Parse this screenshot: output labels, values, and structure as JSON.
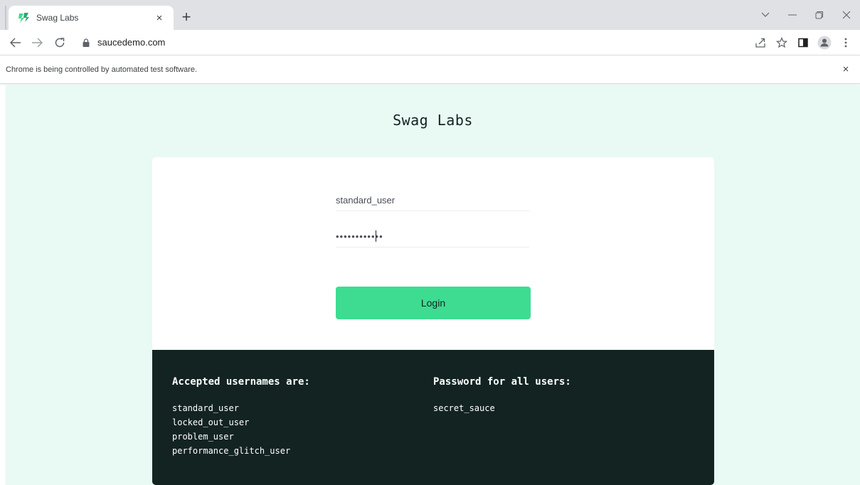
{
  "browser": {
    "tab_title": "Swag Labs",
    "tab_close": "×",
    "new_tab": "+",
    "url": "saucedemo.com",
    "infobar_text": "Chrome is being controlled by automated test software.",
    "infobar_close": "×"
  },
  "page": {
    "logo": "Swag Labs",
    "username_value": "standard_user",
    "password_value": "••••••••••••",
    "login_label": "Login",
    "accepted_usernames_heading": "Accepted usernames are:",
    "usernames": [
      "standard_user",
      "locked_out_user",
      "problem_user",
      "performance_glitch_user"
    ],
    "password_heading": "Password for all users:",
    "password_hint": "secret_sauce"
  },
  "colors": {
    "page_bg": "#e9f9f3",
    "login_button": "#3ddc91",
    "credentials_panel": "#132322"
  }
}
